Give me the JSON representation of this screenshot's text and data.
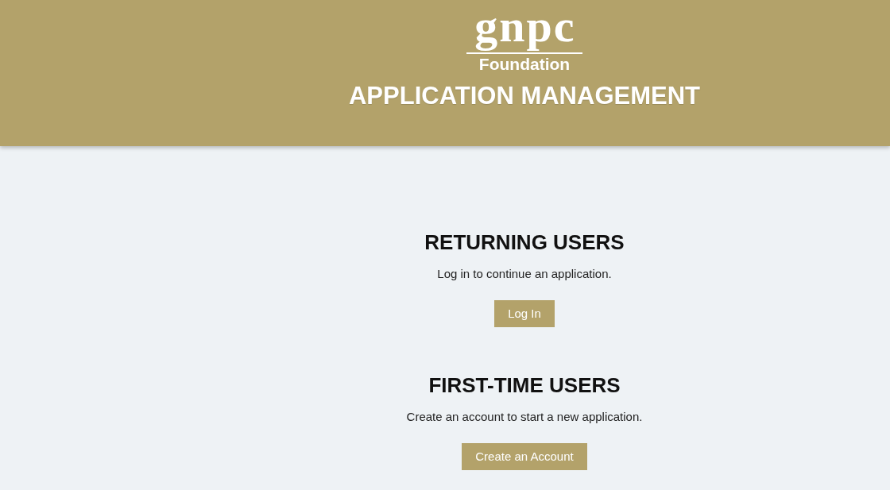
{
  "header": {
    "logo": {
      "wordmark": "gnpc",
      "tagline": "Foundation"
    },
    "title": "APPLICATION MANAGEMENT"
  },
  "sections": [
    {
      "heading": "RETURNING USERS",
      "description": "Log in to continue an application.",
      "button": "Log In"
    },
    {
      "heading": "FIRST-TIME USERS",
      "description": "Create an account to start a new application.",
      "button": "Create an Account"
    }
  ]
}
